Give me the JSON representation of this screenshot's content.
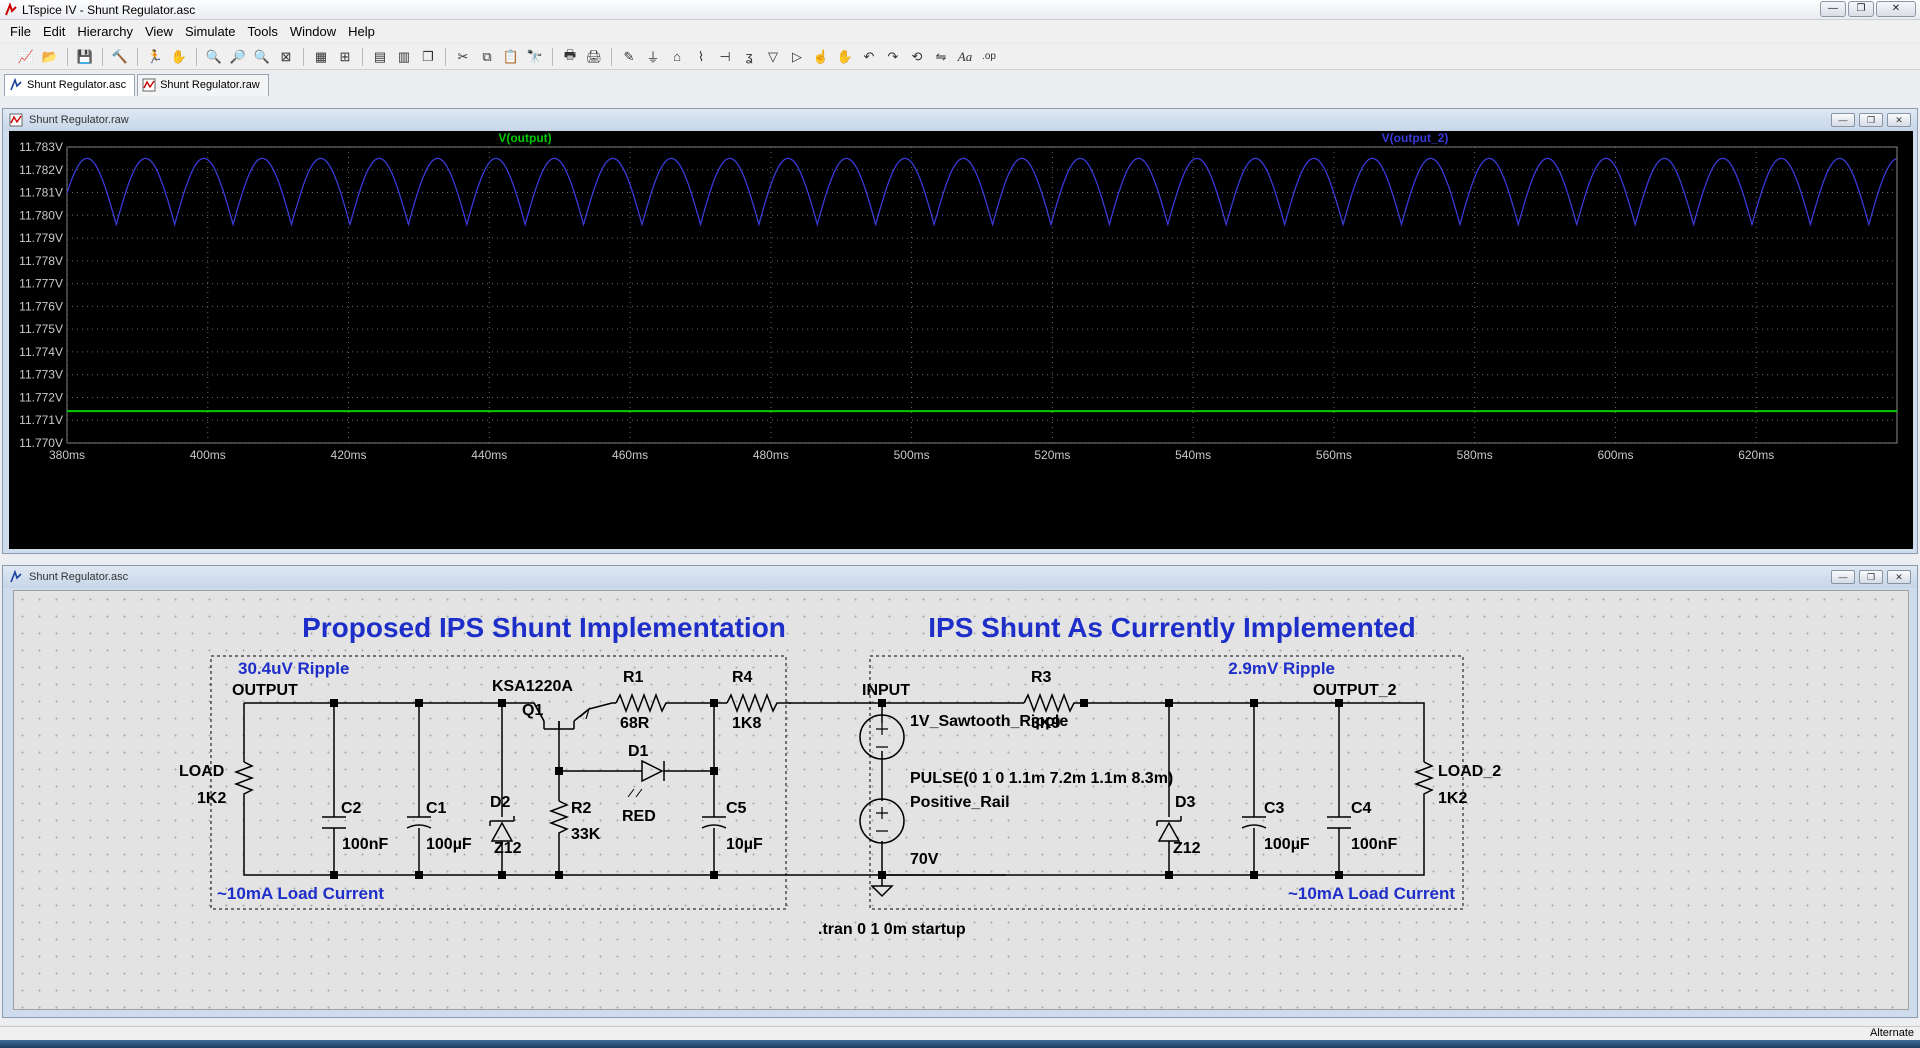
{
  "app": {
    "title": "LTspice IV - Shunt Regulator.asc",
    "window_buttons": [
      "—",
      "❐",
      "✕"
    ],
    "status_text": "Alternate"
  },
  "menu": [
    "File",
    "Edit",
    "Hierarchy",
    "View",
    "Simulate",
    "Tools",
    "Window",
    "Help"
  ],
  "toolbar_icons": [
    "new-schematic-icon",
    "open-icon",
    "save-icon",
    "control-panel-icon",
    "run-icon",
    "halt-icon",
    "zoom-in-icon",
    "zoom-area-icon",
    "zoom-out-icon",
    "zoom-fit-icon",
    "autorange-icon",
    "grid-icon",
    "tile-vertical-icon",
    "tile-horizontal-icon",
    "cascade-icon",
    "cut-icon",
    "copy-icon",
    "paste-icon",
    "find-icon",
    "print-setup-icon",
    "print-icon",
    "wire-icon",
    "ground-icon",
    "label-icon",
    "resistor-icon",
    "capacitor-icon",
    "inductor-icon",
    "diode-icon",
    "component-icon",
    "move-icon",
    "drag-icon",
    "undo-icon",
    "redo-icon",
    "rotate-icon",
    "mirror-icon",
    "text-icon",
    "spice-directive-icon"
  ],
  "tabs": [
    {
      "label": "Shunt Regulator.asc"
    },
    {
      "label": "Shunt Regulator.raw"
    }
  ],
  "waveform_window": {
    "title": "Shunt Regulator.raw",
    "buttons": [
      "—",
      "❐",
      "✕"
    ]
  },
  "schematic_window": {
    "title": "Shunt Regulator.asc",
    "buttons": [
      "—",
      "❐",
      "✕"
    ]
  },
  "chart_data": {
    "type": "line",
    "x_unit": "ms",
    "y_unit": "V",
    "xlim": [
      380,
      640
    ],
    "ylim": [
      11.77,
      11.783
    ],
    "x_ticks": [
      "380ms",
      "400ms",
      "420ms",
      "440ms",
      "460ms",
      "480ms",
      "500ms",
      "520ms",
      "540ms",
      "560ms",
      "580ms",
      "600ms",
      "620ms"
    ],
    "y_ticks": [
      "11.783V",
      "11.782V",
      "11.781V",
      "11.780V",
      "11.779V",
      "11.778V",
      "11.777V",
      "11.776V",
      "11.775V",
      "11.774V",
      "11.773V",
      "11.772V",
      "11.771V",
      "11.770V"
    ],
    "grid": true,
    "series": [
      {
        "name": "V(output)",
        "color": "#00cc00",
        "kind": "flat",
        "value": 11.7714
      },
      {
        "name": "V(output_2)",
        "color": "#3a3ad6",
        "kind": "ripple",
        "period_ms": 8.3,
        "max": 11.7825,
        "min": 11.7796
      }
    ]
  },
  "schematic": {
    "left_title": "Proposed IPS Shunt Implementation",
    "right_title": "IPS Shunt As Currently Implemented",
    "left_ripple": "30.4uV Ripple",
    "right_ripple": "2.9mV Ripple",
    "left_current": "~10mA Load Current",
    "right_current": "~10mA Load Current",
    "directive": ".tran 0 1 0m startup",
    "nets": {
      "output": "OUTPUT",
      "output_2": "OUTPUT_2",
      "input": "INPUT"
    },
    "components": {
      "load": {
        "name": "LOAD",
        "value": "1K2"
      },
      "load2": {
        "name": "LOAD_2",
        "value": "1K2"
      },
      "c2": {
        "name": "C2",
        "value": "100nF"
      },
      "c1": {
        "name": "C1",
        "value": "100µF"
      },
      "d2": {
        "name": "D2",
        "value": "Z12"
      },
      "q1": {
        "name": "Q1",
        "value": "KSA1220A"
      },
      "r1": {
        "name": "R1",
        "value": "68R"
      },
      "r4": {
        "name": "R4",
        "value": "1K8"
      },
      "d1": {
        "name": "D1",
        "value": "RED"
      },
      "r2": {
        "name": "R2",
        "value": "33K"
      },
      "c5": {
        "name": "C5",
        "value": "10µF"
      },
      "v1": {
        "name": "1V_Sawtooth_Ripple",
        "value": "PULSE(0 1 0 1.1m 7.2m 1.1m 8.3m)"
      },
      "v2": {
        "name": "Positive_Rail",
        "value": "70V"
      },
      "r3": {
        "name": "R3",
        "value": "3K9"
      },
      "d3": {
        "name": "D3",
        "value": "Z12"
      },
      "c3": {
        "name": "C3",
        "value": "100µF"
      },
      "c4": {
        "name": "C4",
        "value": "100nF"
      }
    }
  }
}
